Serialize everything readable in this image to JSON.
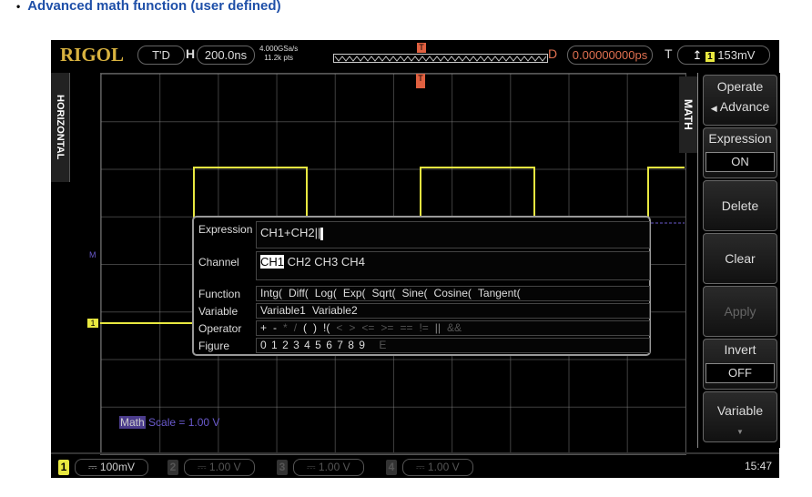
{
  "heading": "Advanced math function (user defined)",
  "topbar": {
    "brand": "RIGOL",
    "mode": "T'D",
    "h_label": "H",
    "timebase": "200.0ns",
    "sample_rate": "4.000GSa/s",
    "memory": "11.2k pts",
    "d_label": "D",
    "delay": "0.00000000ps",
    "t_label": "T",
    "trigger_channel": "1",
    "trigger_level": "153mV"
  },
  "horizontal_tab": "HORIZONTAL",
  "math_tab": "MATH",
  "panel": {
    "operate": "Operate",
    "operate_value": "Advance",
    "expression": "Expression",
    "expression_value": "ON",
    "delete": "Delete",
    "clear": "Clear",
    "apply": "Apply",
    "invert": "Invert",
    "invert_value": "OFF",
    "variable": "Variable"
  },
  "dialog": {
    "expression_label": "Expression",
    "expression_value": "CH1+CH2||",
    "channel_label": "Channel",
    "channels": [
      "CH1",
      "CH2",
      "CH3",
      "CH4"
    ],
    "function_label": "Function",
    "functions": [
      "Intg(",
      "Diff(",
      "Log(",
      "Exp(",
      "Sqrt(",
      "Sine(",
      "Cosine(",
      "Tangent("
    ],
    "variable_label": "Variable",
    "variables": [
      "Variable1",
      "Variable2"
    ],
    "operator_label": "Operator",
    "operators": [
      "+",
      "-",
      "*",
      "/",
      "(",
      ")",
      "!(",
      "<",
      ">",
      "<=",
      ">=",
      "==",
      "!=",
      "||",
      "&&"
    ],
    "figure_label": "Figure",
    "figures": [
      "0",
      "1",
      "2",
      "3",
      "4",
      "5",
      "6",
      "7",
      "8",
      "9",
      "E"
    ]
  },
  "markers": {
    "math": "M",
    "ch1": "1",
    "trigger": "T"
  },
  "math_scale": {
    "label": "Math",
    "value": "Scale = 1.00 V"
  },
  "bottombar": {
    "channels": [
      {
        "num": "1",
        "value": "100mV",
        "color": "#e6e63a"
      },
      {
        "num": "2",
        "value": "1.00 V",
        "color": "#555"
      },
      {
        "num": "3",
        "value": "1.00 V",
        "color": "#555"
      },
      {
        "num": "4",
        "value": "1.00 V",
        "color": "#555"
      }
    ],
    "time": "15:47"
  },
  "colors": {
    "ch1": "#e8e840",
    "math": "#6a5acd",
    "brand": "#d9b340",
    "heading": "#1e4fa8"
  }
}
